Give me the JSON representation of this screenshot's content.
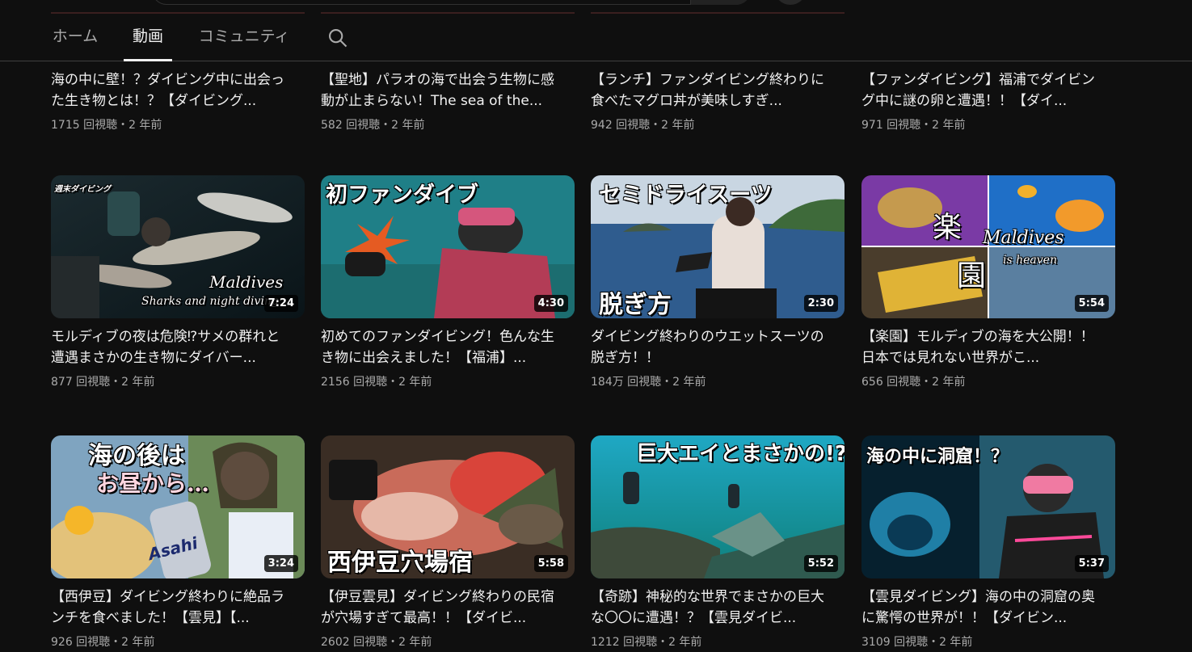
{
  "tabs": [
    {
      "label": "ホーム"
    },
    {
      "label": "動画"
    },
    {
      "label": "コミュニティ"
    }
  ],
  "row0": [
    {
      "title": "海の中に壁！？ダイビング中に出会った生き物とは！？【ダイビング...",
      "meta": "1715 回視聴・2 年前"
    },
    {
      "title": "【聖地】パラオの海で出会う生物に感動が止まらない！The sea of the...",
      "meta": "582 回視聴・2 年前"
    },
    {
      "title": "【ランチ】ファンダイビング終わりに食べたマグロ丼が美味しすぎ...",
      "meta": "942 回視聴・2 年前"
    },
    {
      "title": "【ファンダイビング】福浦でダイビング中に謎の卵と遭遇！！【ダイ...",
      "meta": "971 回視聴・2 年前"
    }
  ],
  "row1": [
    {
      "title": "モルディブの夜は危険⁉サメの群れと遭遇まさかの生き物にダイバー...",
      "meta": "877 回視聴・2 年前",
      "duration": "7:24",
      "overlay": "Maldives",
      "overlay2": "Sharks and night diving",
      "logo": "週末ダイビング"
    },
    {
      "title": "初めてのファンダイビング！色んな生き物に出会えました！【福浦】...",
      "meta": "2156 回視聴・2 年前",
      "duration": "4:30",
      "overlay": "初ファンダイブ"
    },
    {
      "title": "ダイビング終わりのウエットスーツの脱ぎ方！！",
      "meta": "184万 回視聴・2 年前",
      "duration": "2:30",
      "overlay": "セミドライスーツ",
      "overlay2": "脱ぎ方"
    },
    {
      "title": "【楽園】モルディブの海を大公開！！日本では見れない世界がこ...",
      "meta": "656 回視聴・2 年前",
      "duration": "5:54",
      "overlay": "楽",
      "overlay2": "園",
      "overlay3": "Maldives",
      "overlay4": "is heaven"
    }
  ],
  "row2": [
    {
      "title": "【西伊豆】ダイビング終わりに絶品ランチを食べました！【雲見】【...",
      "meta": "926 回視聴・2 年前",
      "duration": "3:24",
      "overlay": "海の後は",
      "overlay2": "お昼から…",
      "can": "Asahi"
    },
    {
      "title": "【伊豆雲見】ダイビング終わりの民宿が穴場すぎて最高！！【ダイビ...",
      "meta": "2602 回視聴・2 年前",
      "duration": "5:58",
      "overlay": "西伊豆穴場宿"
    },
    {
      "title": "【奇跡】神秘的な世界でまさかの巨大な〇〇に遭遇！？【雲見ダイビ...",
      "meta": "1212 回視聴・2 年前",
      "duration": "5:52",
      "overlay": "巨大エイとまさかの!?"
    },
    {
      "title": "【雲見ダイビング】海の中の洞窟の奥に驚愕の世界が！！【ダイビン...",
      "meta": "3109 回視聴・2 年前",
      "duration": "5:37",
      "overlay": "海の中に洞窟！？"
    }
  ]
}
